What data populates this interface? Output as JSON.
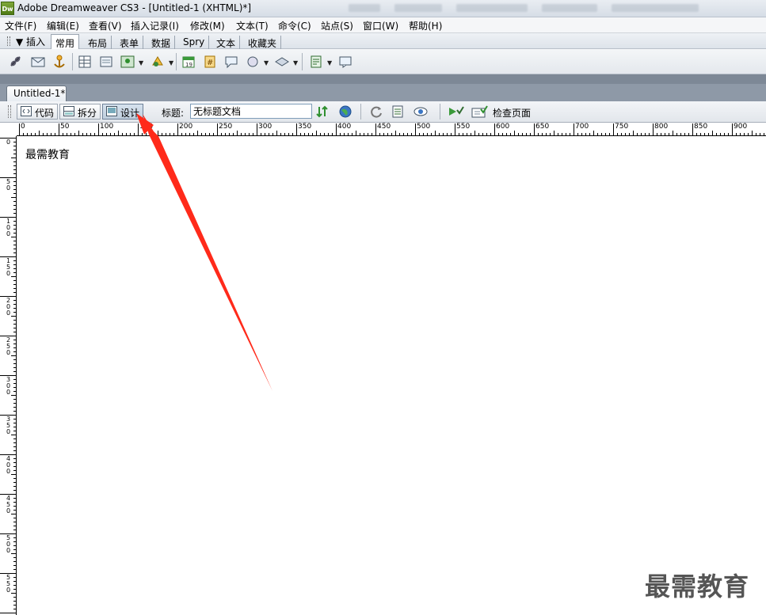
{
  "window": {
    "title": "Adobe Dreamweaver CS3 - [Untitled-1 (XHTML)*]",
    "app_icon": "Dw"
  },
  "menu": [
    "文件(F)",
    "编辑(E)",
    "查看(V)",
    "插入记录(I)",
    "修改(M)",
    "文本(T)",
    "命令(C)",
    "站点(S)",
    "窗口(W)",
    "帮助(H)"
  ],
  "insert_panel": {
    "label": "▼ 插入",
    "tabs": [
      "常用",
      "布局",
      "表单",
      "数据",
      "Spry",
      "文本",
      "收藏夹"
    ],
    "active_tab": "常用",
    "icons": [
      "hyperlink-icon",
      "email-link-icon",
      "named-anchor-icon",
      "table-icon",
      "div-icon",
      "image-icon",
      "media-icon",
      "date-icon",
      "server-comment-icon",
      "comment-icon",
      "head-icon",
      "script-icon",
      "template-icon",
      "tag-chooser-icon"
    ]
  },
  "document": {
    "tab_label": "Untitled-1*",
    "views": {
      "code": "代码",
      "split": "拆分",
      "design": "设计"
    },
    "active_view": "design",
    "title_label": "标题:",
    "title_value": "无标题文档",
    "check_page_label": "检查页面"
  },
  "ruler": {
    "h_labels": [
      "0",
      "50",
      "100",
      "150",
      "200",
      "250",
      "300",
      "350",
      "400",
      "450",
      "500",
      "550",
      "600",
      "650",
      "700",
      "750",
      "800",
      "850",
      "900"
    ],
    "v_labels": [
      "0",
      "50",
      "100",
      "150",
      "200",
      "250",
      "300",
      "350",
      "400",
      "450",
      "500",
      "550"
    ]
  },
  "canvas": {
    "body_text": "最需教育"
  },
  "watermark": "最需教育",
  "colors": {
    "arrow": "#ff2a1a",
    "accent": "#6f8299"
  }
}
